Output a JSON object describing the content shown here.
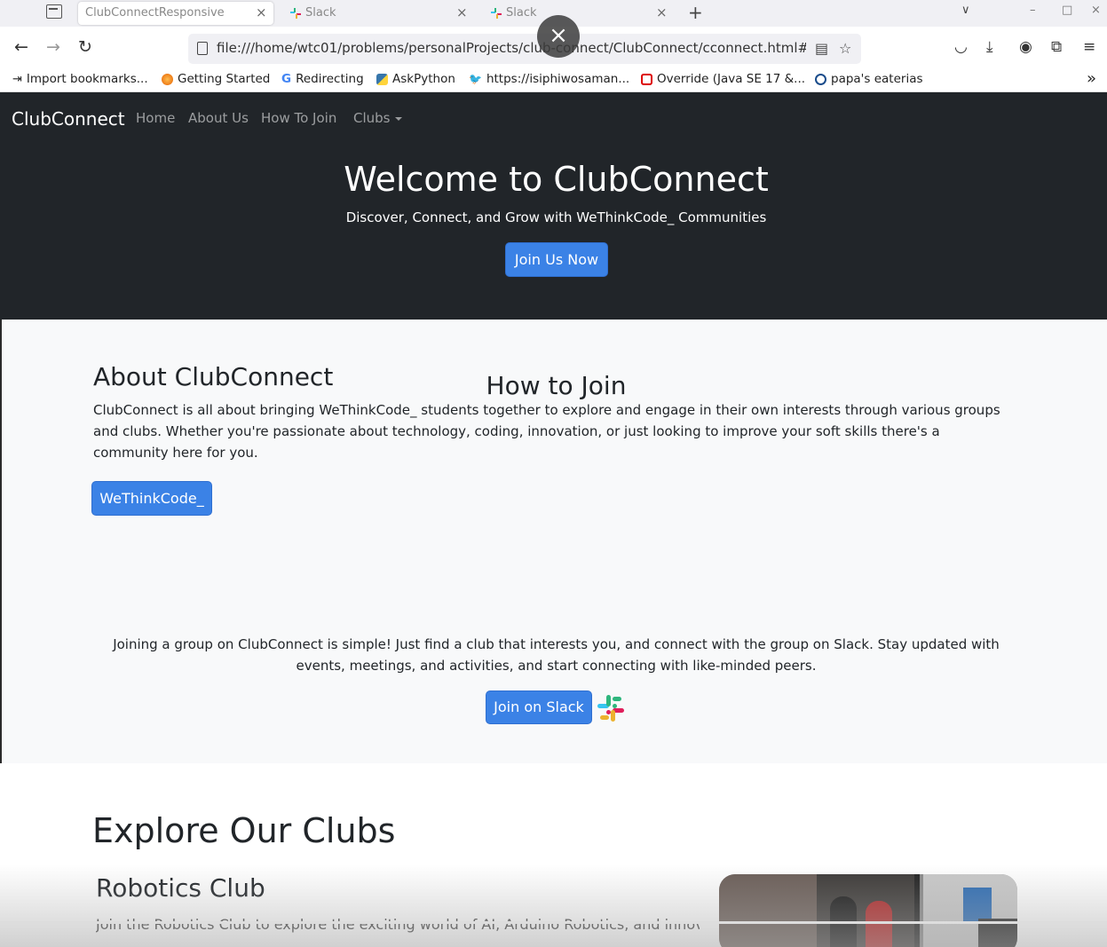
{
  "browser": {
    "tabs": [
      {
        "label": "ClubConnectResponsive",
        "close": "×"
      },
      {
        "label": "Slack",
        "close": "×"
      },
      {
        "label": "Slack",
        "close": "×"
      }
    ],
    "new_tab": "+",
    "tab_list": "∨",
    "window": {
      "minimize": "–",
      "maximize": "□",
      "close": "×"
    },
    "url": "file:///home/wtc01/problems/personalProjects/club-connect/ClubConnect/cconnect.html#about",
    "overlay_close": "×",
    "bookmarks": [
      {
        "label": "Import bookmarks...",
        "icon": "import-icon"
      },
      {
        "label": "Getting Started",
        "icon": "firefox-icon"
      },
      {
        "label": "Redirecting",
        "icon": "google-icon"
      },
      {
        "label": "AskPython",
        "icon": "python-icon"
      },
      {
        "label": "https://isiphiwosaman...",
        "icon": "twitter-icon"
      },
      {
        "label": "Override (Java SE 17 &...",
        "icon": "oracle-icon"
      },
      {
        "label": "papa's eaterias",
        "icon": "globe-icon"
      }
    ],
    "bookmarks_overflow": "»"
  },
  "site": {
    "brand": "ClubConnect",
    "nav": [
      "Home",
      "About Us",
      "How To Join",
      "Clubs"
    ],
    "hero": {
      "title": "Welcome to ClubConnect",
      "subtitle": "Discover, Connect, and Grow with WeThinkCode_ Communities",
      "button": "Join Us Now"
    },
    "about": {
      "title": "About ClubConnect",
      "text": "ClubConnect is all about bringing WeThinkCode_ students together to explore and engage in their own interests through various groups and clubs. Whether you're passionate about technology, coding, innovation, or just looking to improve your soft skills there's a community here for you.",
      "button": "WeThinkCode_"
    },
    "join": {
      "title": "How to Join",
      "text": "Joining a group on ClubConnect is simple! Just find a club that interests you, and connect with the group on Slack. Stay updated with events, meetings, and activities, and start connecting with like-minded peers.",
      "button": "Join on Slack"
    },
    "clubs": {
      "title": "Explore Our Clubs",
      "items": [
        {
          "name": "Robotics Club",
          "text": "Join the Robotics Club to explore the exciting world of AI, Arduino Robotics, and innovative"
        }
      ]
    }
  },
  "colors": {
    "primary": "#3b82e6",
    "dark": "#212529",
    "light": "#f8f9fa"
  }
}
